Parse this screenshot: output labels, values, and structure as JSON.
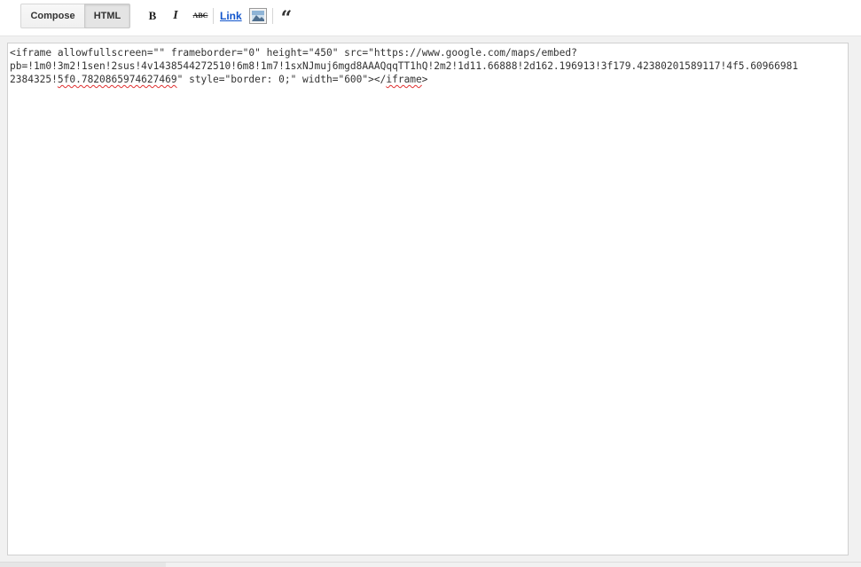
{
  "toolbar": {
    "compose_label": "Compose",
    "html_label": "HTML",
    "bold_label": "B",
    "italic_label": "I",
    "strike_label": "ABC",
    "link_label": "Link",
    "quote_label": "“",
    "active_mode": "HTML"
  },
  "editor": {
    "line1": "<iframe allowfullscreen=\"\" frameborder=\"0\" height=\"450\" src=\"https://www.google.com/maps/embed?",
    "line2": "pb=!1m0!3m2!1sen!2sus!4v1438544272510!6m8!1m7!1sxNJmuj6mgd8AAAQqqTT1hQ!2m2!1d11.66888!2d162.196913!3f179.42380201589117!4f5.60966981",
    "line3_part1": "2384325!",
    "line3_squiggle": "5f0.7820865974627469",
    "line3_part2": "\" style=\"border: 0;\" width=\"600\"></",
    "line3_tag": "iframe",
    "line3_end": ">"
  },
  "colors": {
    "link": "#1155cc",
    "spellcheck": "#e03030",
    "page_bg": "#f1f1f1"
  }
}
